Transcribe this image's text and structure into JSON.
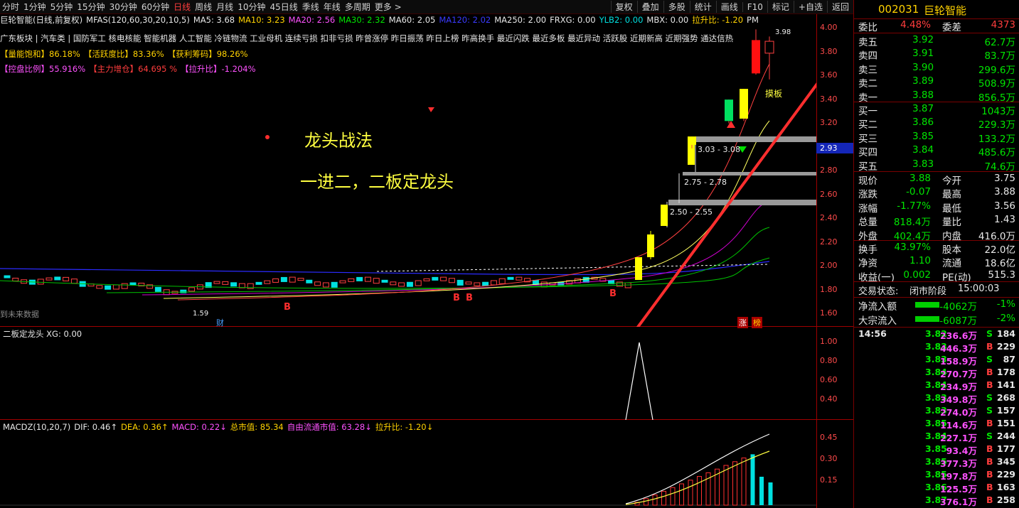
{
  "toolbar": {
    "periods": [
      "分时",
      "1分钟",
      "5分钟",
      "15分钟",
      "30分钟",
      "60分钟",
      "日线",
      "周线",
      "月线",
      "10分钟",
      "45日线",
      "季线",
      "年线",
      "多周期",
      "更多 >"
    ],
    "active": "日线",
    "right_buttons": [
      "复权",
      "叠加",
      "多股",
      "统计",
      "画线",
      "F10",
      "标记",
      "+自选",
      "返回"
    ]
  },
  "main": {
    "title": "巨轮智能(日线,前复权)",
    "mfas": "MFAS(120,60,30,20,10,5)",
    "ma5": "MA5: 3.68",
    "ma10": "MA10: 3.23",
    "ma20": "MA20: 2.56",
    "ma30": "MA30: 2.32",
    "ma60": "MA60: 2.05",
    "ma120": "MA120: 2.02",
    "ma250": "MA250: 2.00",
    "frxg": "FRXG: 0.00",
    "ylb2": "YLB2: 0.00",
    "mbx": "MBX: 0.00",
    "lsb": "拉升比: -1.20",
    "pm": "PM",
    "sectors": "广东板块 | 汽车类 | 国防军工 核电核能 智能机器 人工智能 冷链物流 工业母机 连续亏损 扣非亏损 昨曾涨停 昨日振荡 昨日上榜 昨高换手 最近闪跌 最近多板 最近异动 活跃股 近期新高 近期强势 通达信热",
    "ind1": [
      "【量能饱和】86.18%",
      "【活跃度比】83.36%",
      "【获利筹码】98.26%"
    ],
    "ind2": [
      "【控盘比例】55.916%",
      "【主力增仓】64.695 %",
      "【拉升比】-1.204%"
    ],
    "text1": "龙头战法",
    "text2": "一进二，二板定龙头",
    "zone1": "3.03 - 3.08",
    "zone2": "2.75 - 2.78",
    "zone3": "2.50 - 2.55",
    "mark_top": "3.98",
    "mark_low": "1.59",
    "touban": "摸板",
    "future": "到未来数据",
    "cai": "财",
    "zhang": "涨",
    "bang": "榜",
    "b_mark": "B",
    "price_tag": "2.93",
    "ticks": [
      "4.00",
      "3.80",
      "3.60",
      "3.40",
      "3.20",
      "3.00",
      "2.80",
      "2.60",
      "2.40",
      "2.20",
      "2.00",
      "1.80",
      "1.60"
    ]
  },
  "pane2": {
    "title": "二板定龙头  XG: 0.00",
    "ticks": [
      "1.00",
      "0.80",
      "0.60",
      "0.40"
    ]
  },
  "pane3": {
    "macd": "MACDZ(10,20,7)",
    "dif": "DIF: 0.46↑",
    "dea": "DEA: 0.36↑",
    "macdv": "MACD: 0.22↓",
    "zsz": "总市值: 85.34",
    "ltsz": "自由流通市值: 63.28↓",
    "lsb": "拉升比: -1.20↓",
    "ticks": [
      "0.45",
      "0.30",
      "0.15"
    ]
  },
  "chart_data": {
    "type": "candlestick",
    "period": "日线",
    "candles": [
      {
        "o": 3.01,
        "h": 3.08,
        "l": 2.98,
        "c": 3.08
      },
      {
        "o": 3.39,
        "h": 3.39,
        "l": 3.19,
        "c": 3.21
      },
      {
        "o": 3.23,
        "h": 3.48,
        "l": 3.21,
        "c": 3.48
      },
      {
        "o": 3.89,
        "h": 3.98,
        "l": 3.6,
        "c": 3.61
      },
      {
        "o": 3.78,
        "h": 3.92,
        "l": 3.56,
        "c": 3.88
      }
    ]
  },
  "quote": {
    "code": "002031",
    "name": "巨轮智能",
    "weibi_label": "委比",
    "weibi": "4.48%",
    "weicha_label": "委差",
    "weicha": "4373",
    "asks": [
      {
        "label": "卖五",
        "price": "3.92",
        "vol": "62.7万"
      },
      {
        "label": "卖四",
        "price": "3.91",
        "vol": "83.7万"
      },
      {
        "label": "卖三",
        "price": "3.90",
        "vol": "299.6万"
      },
      {
        "label": "卖二",
        "price": "3.89",
        "vol": "508.9万"
      },
      {
        "label": "卖一",
        "price": "3.88",
        "vol": "856.5万"
      }
    ],
    "bids": [
      {
        "label": "买一",
        "price": "3.87",
        "vol": "1043万"
      },
      {
        "label": "买二",
        "price": "3.86",
        "vol": "229.3万"
      },
      {
        "label": "买三",
        "price": "3.85",
        "vol": "133.2万"
      },
      {
        "label": "买四",
        "price": "3.84",
        "vol": "485.6万"
      },
      {
        "label": "买五",
        "price": "3.83",
        "vol": "74.6万"
      }
    ],
    "stats": [
      {
        "l1": "现价",
        "v1": "3.88",
        "l2": "今开",
        "v2": "3.75"
      },
      {
        "l1": "涨跌",
        "v1": "-0.07",
        "l2": "最高",
        "v2": "3.88"
      },
      {
        "l1": "涨幅",
        "v1": "-1.77%",
        "l2": "最低",
        "v2": "3.56"
      },
      {
        "l1": "总量",
        "v1": "818.4万",
        "l2": "量比",
        "v2": "1.43"
      },
      {
        "l1": "外盘",
        "v1": "402.4万",
        "l2": "内盘",
        "v2": "416.0万"
      }
    ],
    "stats2": [
      {
        "l1": "换手",
        "v1": "43.97%",
        "l2": "股本",
        "v2": "22.0亿"
      },
      {
        "l1": "净资",
        "v1": "1.10",
        "l2": "流通",
        "v2": "18.6亿"
      },
      {
        "l1": "收益(一)",
        "v1": "0.002",
        "l2": "PE(动)",
        "v2": "515.3"
      }
    ],
    "trade_status_label": "交易状态:",
    "trade_status": "闭市阶段",
    "trade_time": "15:00:03",
    "netflow_label": "净流入额",
    "netflow": "-4062万",
    "netflow_pct": "-1%",
    "bigflow_label": "大宗流入",
    "bigflow": "-6087万",
    "bigflow_pct": "-2%",
    "ticks_first_time": "14:56",
    "ticks": [
      {
        "p": "3.82",
        "v": "236.6万",
        "s": "S",
        "n": "184"
      },
      {
        "p": "3.83",
        "v": "446.3万",
        "s": "B",
        "n": "229"
      },
      {
        "p": "3.83",
        "v": "158.9万",
        "s": "S",
        "n": "87"
      },
      {
        "p": "3.84",
        "v": "270.7万",
        "s": "B",
        "n": "178"
      },
      {
        "p": "3.84",
        "v": "234.9万",
        "s": "B",
        "n": "141"
      },
      {
        "p": "3.83",
        "v": "349.8万",
        "s": "S",
        "n": "268"
      },
      {
        "p": "3.83",
        "v": "274.0万",
        "s": "S",
        "n": "157"
      },
      {
        "p": "3.85",
        "v": "114.6万",
        "s": "B",
        "n": "151"
      },
      {
        "p": "3.84",
        "v": "227.1万",
        "s": "S",
        "n": "244"
      },
      {
        "p": "3.85",
        "v": "93.4万",
        "s": "B",
        "n": "177"
      },
      {
        "p": "3.85",
        "v": "377.3万",
        "s": "B",
        "n": "345"
      },
      {
        "p": "3.85",
        "v": "197.8万",
        "s": "B",
        "n": "229"
      },
      {
        "p": "3.86",
        "v": "125.5万",
        "s": "B",
        "n": "163"
      },
      {
        "p": "3.87",
        "v": "376.1万",
        "s": "B",
        "n": "258"
      }
    ]
  }
}
